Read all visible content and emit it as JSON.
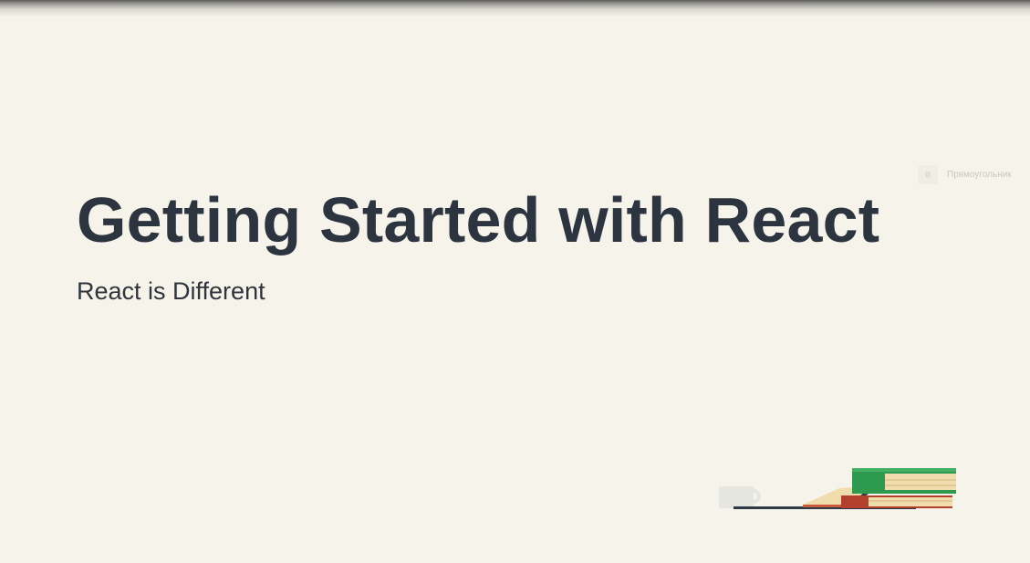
{
  "slide": {
    "title": "Getting Started with React",
    "subtitle": "React is Different"
  },
  "overlay": {
    "label": "Прямоугольник",
    "icon": "gear-icon"
  },
  "illustration": {
    "icon": "books-and-cup-icon"
  },
  "colors": {
    "background": "#f6f4ea",
    "title": "#2c3440",
    "book_green": "#2e9a4f",
    "book_red": "#b3402c",
    "book_cream": "#f1dcae"
  }
}
